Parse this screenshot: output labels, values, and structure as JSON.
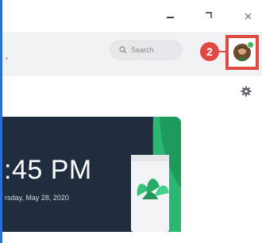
{
  "window": {
    "controls": {
      "minimize": "—",
      "maximize": "❐",
      "close": "✕"
    }
  },
  "header": {
    "search": {
      "label": "Search",
      "icon": "search-icon"
    },
    "step_badge": "2",
    "avatar": {
      "icon": "avatar",
      "presence": "online",
      "presence_color": "#3dbb5d"
    },
    "settings_icon": "gear-icon",
    "highlight_color": "#e04a44"
  },
  "home_card": {
    "time": ":45 PM",
    "date": "rsday, May 28, 2020",
    "background": "#1f2d3f"
  }
}
